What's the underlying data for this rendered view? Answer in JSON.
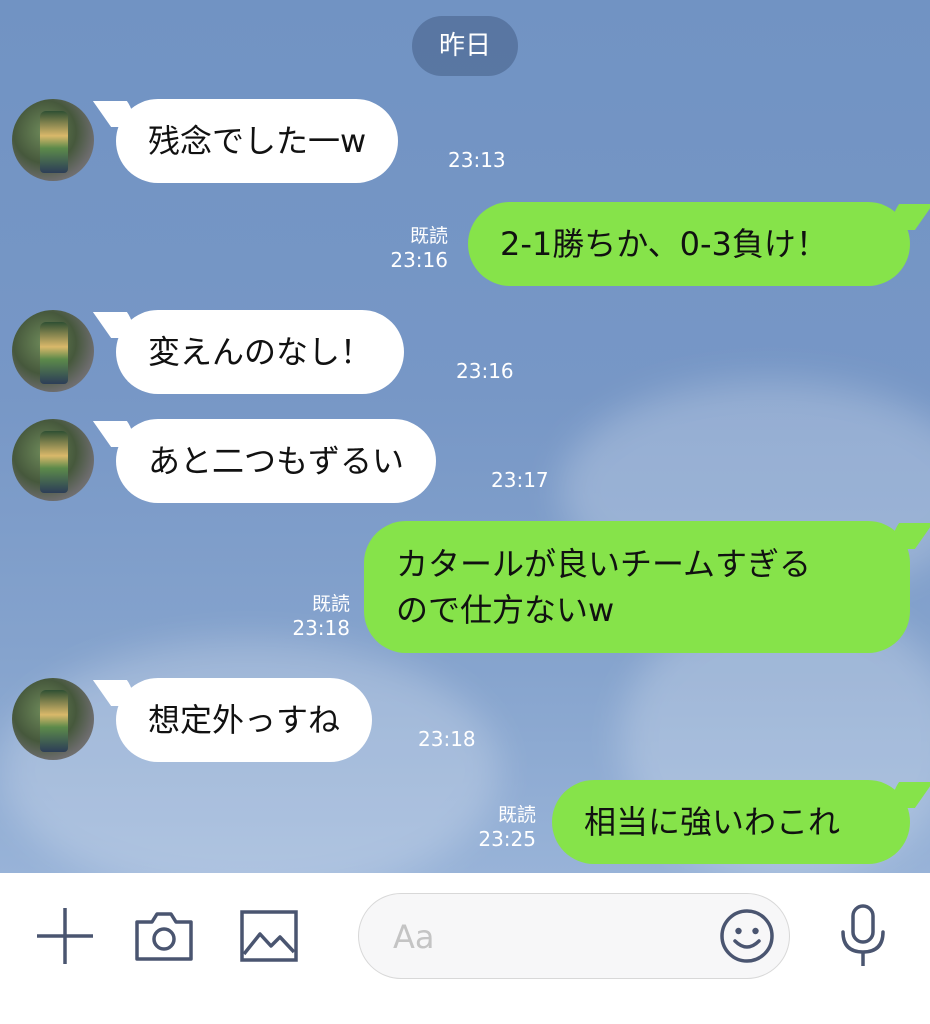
{
  "chat": {
    "date_label": "昨日",
    "messages": [
      {
        "side": "in",
        "lines": [
          "残念でした一w"
        ],
        "time": "23:13"
      },
      {
        "side": "out",
        "lines": [
          "2-1勝ちか、0-3負け！"
        ],
        "read": "既読",
        "time": "23:16"
      },
      {
        "side": "in",
        "lines": [
          "変えんのなし！"
        ],
        "time": "23:16"
      },
      {
        "side": "in",
        "lines": [
          "あと二つもずるい"
        ],
        "time": "23:17"
      },
      {
        "side": "out",
        "lines": [
          "カタールが良いチームすぎる",
          "ので仕方ないw"
        ],
        "read": "既読",
        "time": "23:18"
      },
      {
        "side": "in",
        "lines": [
          "想定外っすね"
        ],
        "time": "23:18"
      },
      {
        "side": "out",
        "lines": [
          "相当に強いわこれ"
        ],
        "read": "既読",
        "time": "23:25"
      }
    ]
  },
  "input_bar": {
    "placeholder": "Aa",
    "icons": [
      "plus-icon",
      "camera-icon",
      "image-icon",
      "emoji-icon",
      "microphone-icon"
    ]
  },
  "colors": {
    "outgoing_bubble": "#86e34a",
    "incoming_bubble": "#ffffff",
    "background": "#7193c3",
    "icon": "#4a5570"
  }
}
